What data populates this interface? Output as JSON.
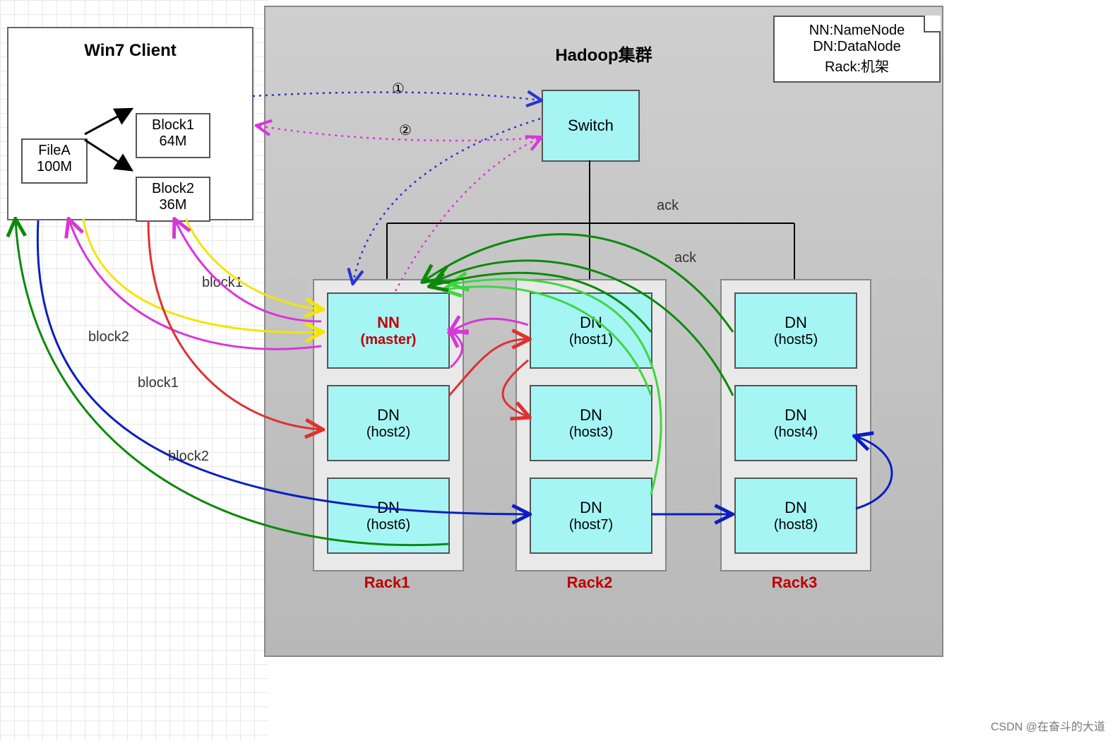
{
  "client": {
    "title": "Win7 Client",
    "file": {
      "name": "FileA",
      "size": "100M"
    },
    "blocks": [
      {
        "name": "Block1",
        "size": "64M"
      },
      {
        "name": "Block2",
        "size": "36M"
      }
    ]
  },
  "cluster": {
    "title": "Hadoop集群",
    "switch_label": "Switch",
    "racks": [
      {
        "label": "Rack1",
        "nodes": [
          {
            "line1": "NN",
            "line2": "(master)",
            "master": true
          },
          {
            "line1": "DN",
            "line2": "(host2)"
          },
          {
            "line1": "DN",
            "line2": "(host6)"
          }
        ]
      },
      {
        "label": "Rack2",
        "nodes": [
          {
            "line1": "DN",
            "line2": "(host1)"
          },
          {
            "line1": "DN",
            "line2": "(host3)"
          },
          {
            "line1": "DN",
            "line2": "(host7)"
          }
        ]
      },
      {
        "label": "Rack3",
        "nodes": [
          {
            "line1": "DN",
            "line2": "(host5)"
          },
          {
            "line1": "DN",
            "line2": "(host4)"
          },
          {
            "line1": "DN",
            "line2": "(host8)"
          }
        ]
      }
    ]
  },
  "legend": {
    "lines": [
      "NN:NameNode",
      "DN:DataNode",
      "Rack:机架"
    ]
  },
  "step_labels": {
    "one": "①",
    "two": "②"
  },
  "edge_labels": {
    "block1_a": "block1",
    "block2_a": "block2",
    "block1_b": "block1",
    "block2_b": "block2",
    "ack1": "ack",
    "ack2": "ack"
  },
  "colors": {
    "yellow": "#f2e600",
    "magenta": "#d836d8",
    "red": "#e03030",
    "blue_dashed": "#2a33d6",
    "green_dark": "#0a8a0a",
    "green_light": "#3fd63f",
    "navy": "#0b1fbf"
  },
  "watermark": "CSDN @在奋斗的大道"
}
